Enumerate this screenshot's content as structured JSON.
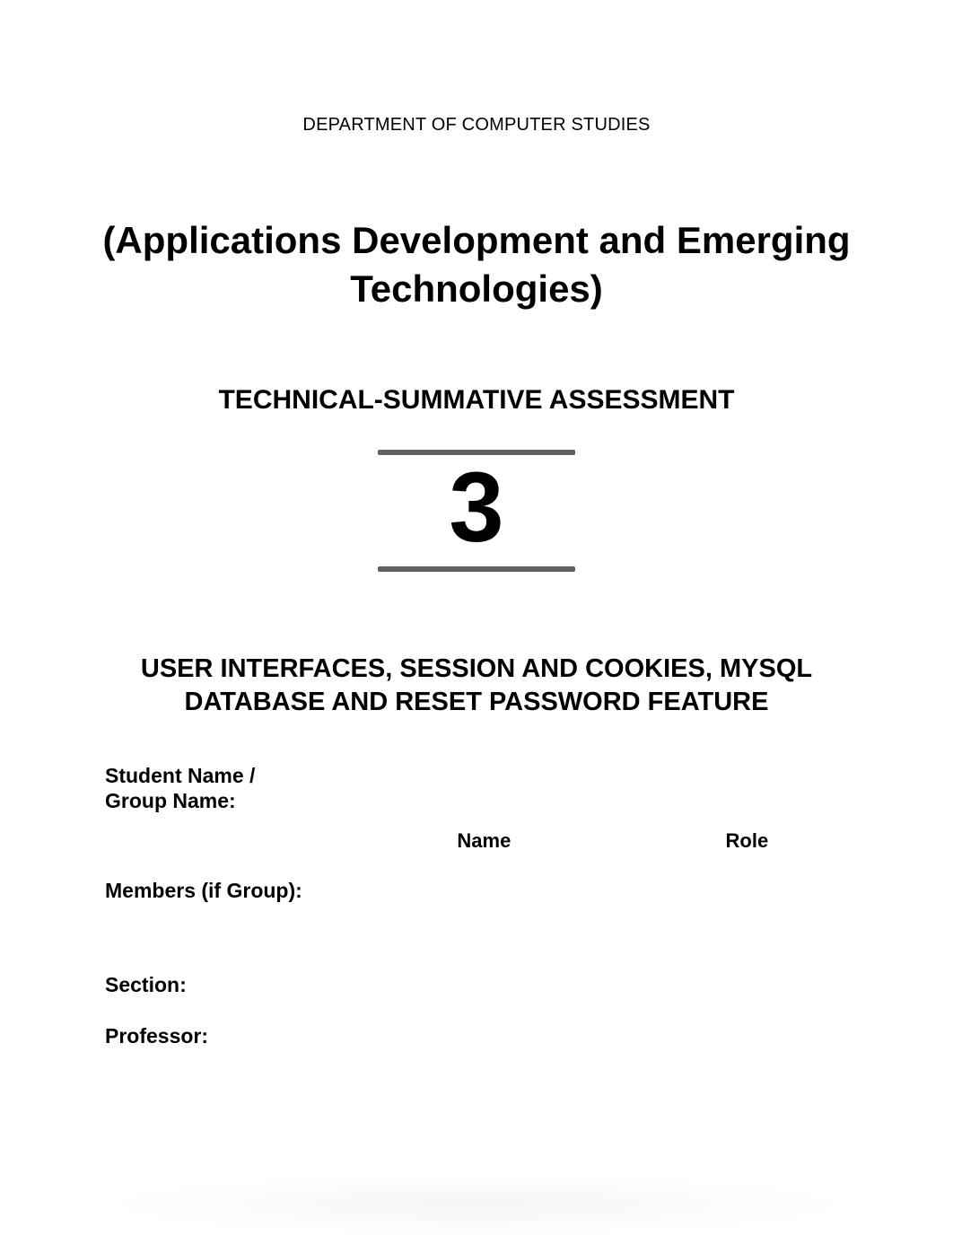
{
  "header": {
    "department": "DEPARTMENT OF COMPUTER STUDIES"
  },
  "course": {
    "title": "(Applications Development and Emerging Technologies)"
  },
  "assessment": {
    "label": "TECHNICAL-SUMMATIVE ASSESSMENT",
    "number": "3",
    "topic": "USER INTERFACES, SESSION AND COOKIES, MYSQL DATABASE AND RESET PASSWORD FEATURE"
  },
  "form": {
    "student_group_label": "Student Name / Group Name:",
    "student_group_value": "",
    "members_label": "Members (if Group):",
    "members_table": {
      "headers": {
        "name": "Name",
        "role": "Role"
      },
      "rows": [
        {
          "name": "",
          "role": ""
        },
        {
          "name": "",
          "role": ""
        },
        {
          "name": "",
          "role": ""
        }
      ]
    },
    "section_label": "Section:",
    "section_value": "",
    "professor_label": "Professor:",
    "professor_value": ""
  }
}
